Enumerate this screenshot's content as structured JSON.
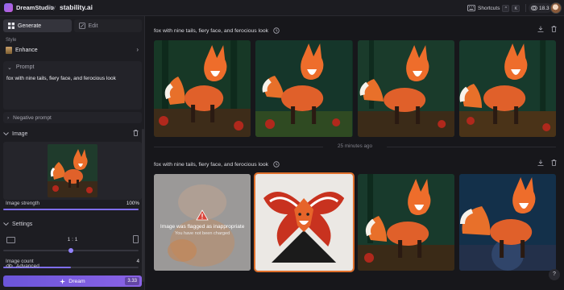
{
  "app": {
    "name": "DreamStudio",
    "by": "by",
    "company": "stability.ai"
  },
  "header": {
    "shortcuts_label": "Shortcuts",
    "key1": "^",
    "key2": "K",
    "credits": "18.3"
  },
  "tabs": {
    "generate": "Generate",
    "edit": "Edit"
  },
  "style": {
    "label": "Style",
    "value": "Enhance"
  },
  "prompt": {
    "label": "Prompt",
    "text": "fox with nine tails, fiery face, and ferocious look"
  },
  "negative_prompt": {
    "label": "Negative prompt"
  },
  "image_section": {
    "label": "Image",
    "strength_label": "Image strength",
    "strength_value": "100%",
    "strength_level": 1.0
  },
  "settings": {
    "label": "Settings",
    "ratio": "1 : 1",
    "count_label": "Image count",
    "count_value": "4",
    "count_level": 0.5,
    "ratio_level": 0.5
  },
  "advanced": {
    "label": "Advanced"
  },
  "dream": {
    "label": "Dream",
    "cost": "3.33"
  },
  "generations": [
    {
      "prompt": "fox with nine tails, fiery face, and ferocious look"
    },
    {
      "prompt": "fox with nine tails, fiery face, and ferocious look"
    }
  ],
  "timestamp": "25 minutes ago",
  "flagged": {
    "title": "Image was flagged as inappropriate",
    "subtitle": "You have not been charged"
  },
  "help": "?",
  "colors": {
    "accent": "#7f6ef0",
    "selected": "#e0702c",
    "background": "#17171b"
  }
}
